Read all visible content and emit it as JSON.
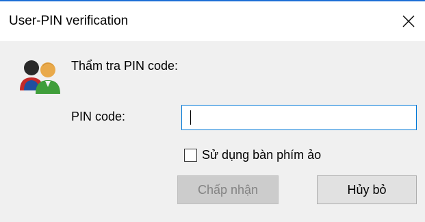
{
  "window": {
    "title": "User-PIN verification",
    "close_icon": "close-icon",
    "accent_color": "#1d6fd6"
  },
  "dialog": {
    "icon": "users-icon",
    "header_label": "Thẩm tra PIN code:",
    "pin_label": "PIN code:",
    "pin_value": "",
    "virtual_keyboard_label": "Sử dụng bàn phím ảo",
    "virtual_keyboard_checked": false,
    "accept_label": "Chấp nhận",
    "accept_enabled": false,
    "cancel_label": "Hủy bỏ"
  }
}
